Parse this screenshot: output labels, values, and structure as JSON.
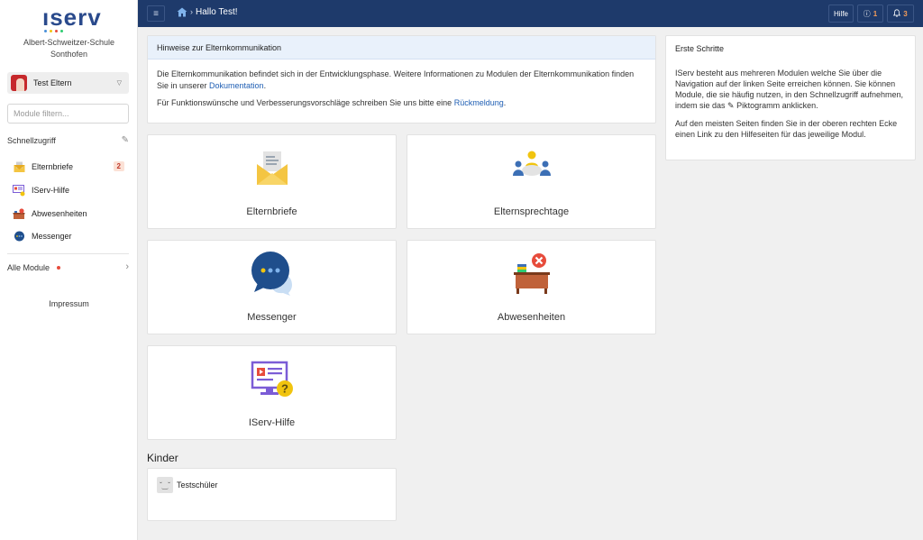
{
  "sidebar": {
    "logo_text": "ıserv",
    "school_line1": "Albert-Schweitzer-Schule",
    "school_line2": "Sonthofen",
    "user_name": "Test Eltern",
    "filter_placeholder": "Module filtern...",
    "quick_access_label": "Schnellzugriff",
    "items": [
      {
        "label": "Elternbriefe",
        "badge": "2",
        "icon": "letter-icon"
      },
      {
        "label": "IServ-Hilfe",
        "icon": "help-monitor-icon"
      },
      {
        "label": "Abwesenheiten",
        "icon": "absence-icon"
      },
      {
        "label": "Messenger",
        "icon": "chat-icon"
      }
    ],
    "all_modules_label": "Alle Module",
    "impressum_label": "Impressum"
  },
  "topbar": {
    "title": "Hallo Test!",
    "help_label": "Hilfe",
    "info_count": "1",
    "notification_count": "3"
  },
  "info": {
    "heading": "Hinweise zur Elternkommunikation",
    "para1_text": "Die Elternkommunikation befindet sich in der Entwicklungsphase. Weitere Informationen zu Modulen der Elternkommunikation finden Sie in unserer ",
    "para1_link": "Dokumentation",
    "para1_end": ".",
    "para2_text": "Für Funktionswünsche und Verbesserungsvorschläge schreiben Sie uns bitte eine ",
    "para2_link": "Rückmeldung",
    "para2_end": "."
  },
  "first_steps": {
    "title": "Erste Schritte",
    "para1_a": "IServ besteht aus mehreren Modulen welche Sie über die Navigation auf der linken Seite erreichen können. Sie können Module, die sie häufig nutzen, in den Schnellzugriff aufnehmen, indem sie das ",
    "para1_b": " Piktogramm anklicken.",
    "para2": "Auf den meisten Seiten finden Sie in der oberen rechten Ecke einen Link zu den Hilfeseiten für das jeweilige Modul."
  },
  "tiles": [
    {
      "label": "Elternbriefe",
      "icon": "letter-icon"
    },
    {
      "label": "Elternsprechtage",
      "icon": "meeting-icon"
    },
    {
      "label": "Messenger",
      "icon": "chat-icon"
    },
    {
      "label": "Abwesenheiten",
      "icon": "absence-icon"
    },
    {
      "label": "IServ-Hilfe",
      "icon": "help-monitor-icon"
    }
  ],
  "kinder": {
    "title": "Kinder",
    "children": [
      {
        "name": "Testschüler",
        "avatar_text": "ˇ‿ˇ"
      }
    ]
  }
}
